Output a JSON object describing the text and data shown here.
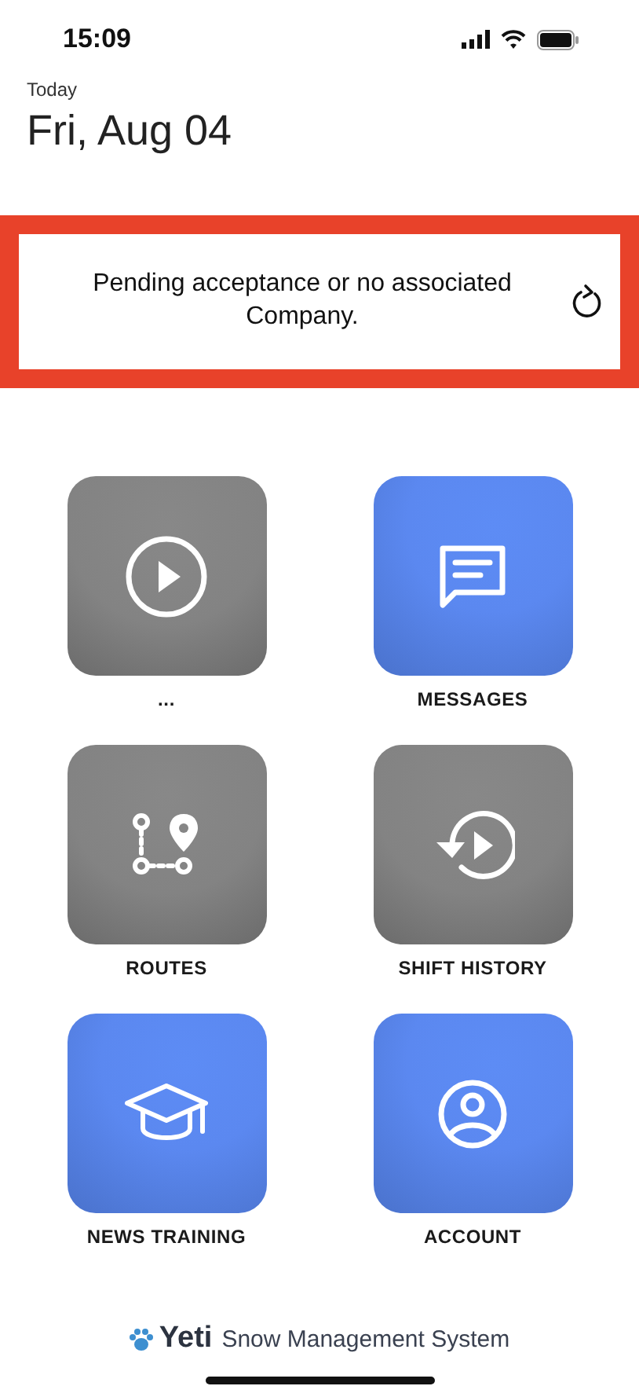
{
  "status_bar": {
    "time": "15:09"
  },
  "header": {
    "caption": "Today",
    "date": "Fri, Aug 04"
  },
  "notice": {
    "message": "Pending acceptance or no associated Company."
  },
  "tiles": [
    {
      "label": "...",
      "enabled": false
    },
    {
      "label": "MESSAGES",
      "enabled": true
    },
    {
      "label": "ROUTES",
      "enabled": false
    },
    {
      "label": "SHIFT HISTORY",
      "enabled": false
    },
    {
      "label": "NEWS TRAINING",
      "enabled": true
    },
    {
      "label": "ACCOUNT",
      "enabled": true
    }
  ],
  "footer": {
    "brand": "Yeti",
    "tagline": "Snow Management System"
  }
}
